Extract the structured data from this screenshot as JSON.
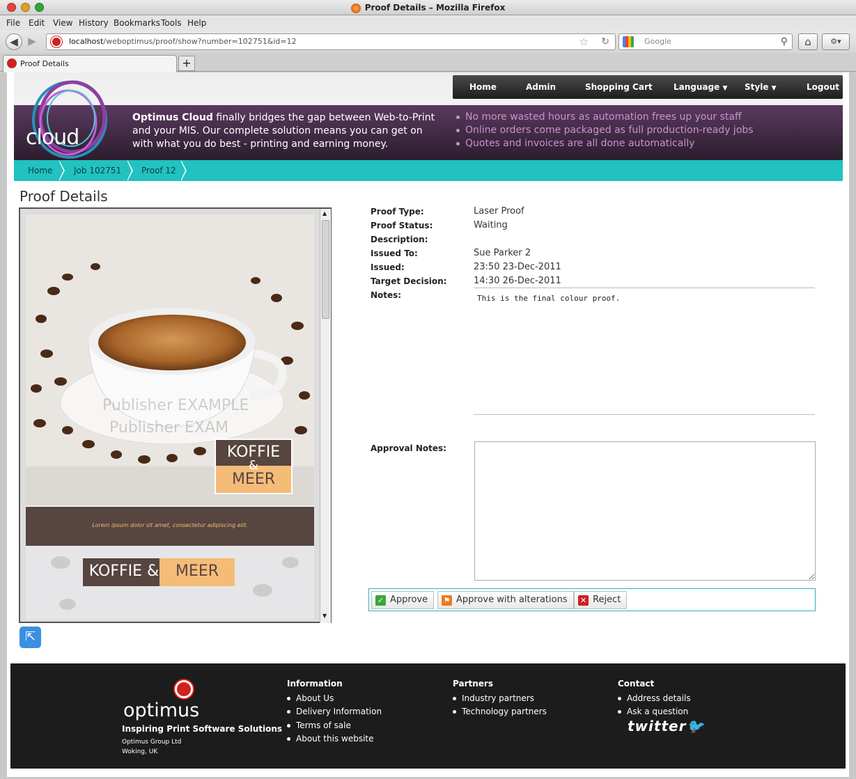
{
  "window": {
    "title": "Proof Details – Mozilla Firefox"
  },
  "menus": [
    "File",
    "Edit",
    "View",
    "History",
    "Bookmarks",
    "Tools",
    "Help"
  ],
  "browser": {
    "url_host": "localhost",
    "url_path": "/weboptimus/proof/show?number=102751&id=12",
    "search_placeholder": "Google",
    "tab_label": "Proof Details"
  },
  "site": {
    "logo_text": "cloud",
    "nav": [
      "Home",
      "Admin",
      "Shopping Cart",
      "Language",
      "Style",
      "Logout"
    ],
    "banner_bold": "Optimus Cloud",
    "banner_text": " finally bridges the gap between Web-to-Print and your MIS. Our complete solution means you can get on with what you do best - printing and earning money.",
    "bullets": [
      "No more wasted hours as automation frees up your staff",
      "Online orders come packaged as full production-ready jobs",
      "Quotes and invoices are all done automatically"
    ],
    "breadcrumb": [
      "Home",
      "Job 102751",
      "Proof 12"
    ]
  },
  "page_title": "Proof Details",
  "poster": {
    "watermark1": "Publisher EXAMPLE",
    "watermark2": "Publisher EXAM",
    "tag_top": "KOFFIE",
    "tag_amp": "&",
    "tag_bottom": "MEER",
    "lorem": "Lorem ipsum dolor sit amet, consectetur adipiscing elit.",
    "bottom_left": "KOFFIE &",
    "bottom_right": "MEER"
  },
  "details": {
    "labels": {
      "type": "Proof Type:",
      "status": "Proof Status:",
      "description": "Description:",
      "issued_to": "Issued To:",
      "issued": "Issued:",
      "target": "Target Decision:",
      "notes": "Notes:",
      "approval": "Approval Notes:"
    },
    "values": {
      "type": "Laser Proof",
      "status": "Waiting",
      "description": "",
      "issued_to": "Sue Parker 2",
      "issued": "23:50 23-Dec-2011",
      "target": "14:30 26-Dec-2011",
      "notes": "This is the final colour proof."
    }
  },
  "buttons": {
    "approve": "Approve",
    "approve_alt": "Approve with alterations",
    "reject": "Reject"
  },
  "footer": {
    "brand": "optimus",
    "tagline": "Inspiring Print Software Solutions",
    "company": "Optimus Group Ltd",
    "location": "Woking, UK",
    "info_title": "Information",
    "info": [
      "About Us",
      "Delivery Information",
      "Terms of sale",
      "About this website"
    ],
    "partners_title": "Partners",
    "partners": [
      "Industry partners",
      "Technology partners"
    ],
    "contact_title": "Contact",
    "contact": [
      "Address details",
      "Ask a question"
    ],
    "twitter": "twitter"
  },
  "colors": {
    "accent": "#21c2c0",
    "banner": "#3d2940",
    "footer": "#1c1c1c"
  }
}
